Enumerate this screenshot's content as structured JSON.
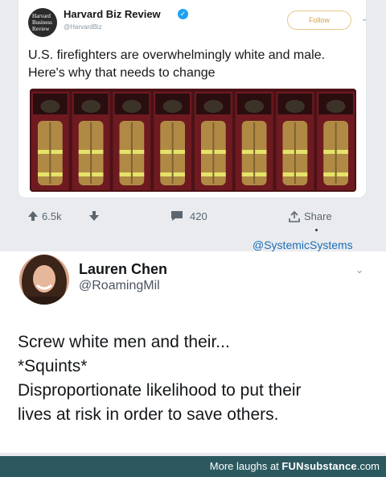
{
  "hbr_tweet": {
    "logo_lines": [
      "Harvard",
      "Business",
      "Review"
    ],
    "name": "Harvard Biz Review",
    "handle": "@HarvardBiz",
    "follow_label": "Follow",
    "text": "U.S. firefighters are overwhelmingly white and male. Here's why that needs to change",
    "photo_alt": "firefighter-gear-lockers"
  },
  "actions": {
    "upvotes": "6.5k",
    "comments": "420",
    "share_label": "Share"
  },
  "credit": "@SystemicSystems",
  "reply": {
    "name": "Lauren Chen",
    "handle": "@RoamingMil",
    "lines": [
      "Screw white men and their...",
      "*Squints*",
      "Disproportionate likelihood to put their",
      "lives at risk in order to save others."
    ]
  },
  "footer": {
    "prefix": "More laughs at ",
    "brand": "FUNsubstance",
    "suffix": ".com"
  },
  "colors": {
    "verified": "#1da1f2",
    "credit": "#1d6fb8",
    "footer_bg": "#2c5960",
    "follow": "#d4a44c"
  }
}
